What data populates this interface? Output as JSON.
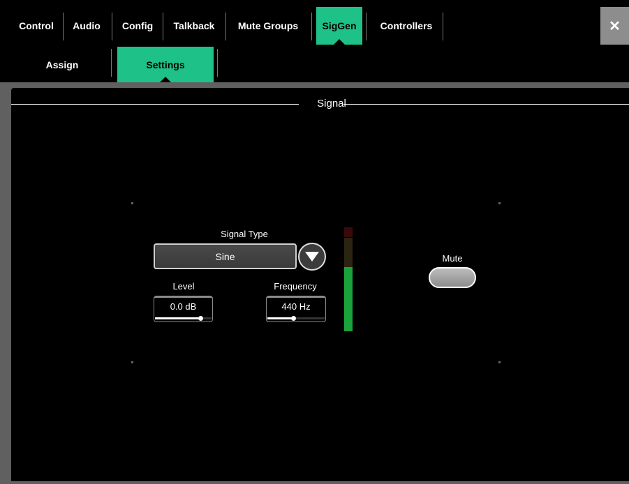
{
  "tabs": [
    {
      "label": "Control",
      "active": false
    },
    {
      "label": "Audio",
      "active": false
    },
    {
      "label": "Config",
      "active": false
    },
    {
      "label": "Talkback",
      "active": false
    },
    {
      "label": "Mute Groups",
      "active": false
    },
    {
      "label": "SigGen",
      "active": true
    },
    {
      "label": "Controllers",
      "active": false
    }
  ],
  "close_icon": "close-icon",
  "subtabs": [
    {
      "label": "Assign",
      "active": false
    },
    {
      "label": "Settings",
      "active": true
    }
  ],
  "section": {
    "title": "Signal"
  },
  "signal_type": {
    "label": "Signal Type",
    "value": "Sine",
    "dropdown_icon": "chevron-down-icon"
  },
  "level": {
    "label": "Level",
    "value": "0.0 dB",
    "slider_fraction": 0.8
  },
  "frequency": {
    "label": "Frequency",
    "value": "440 Hz",
    "slider_fraction": 0.45
  },
  "meter": {
    "level_fraction": 0.62
  },
  "mute": {
    "label": "Mute"
  },
  "colors": {
    "accent": "#1ec187",
    "meter_green": "#1aa33a",
    "meter_dark_red": "#3a0a0a",
    "frame": "#606060"
  }
}
